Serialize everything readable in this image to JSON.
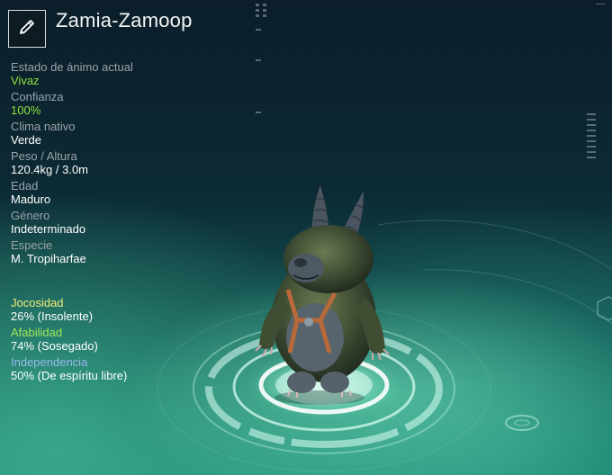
{
  "creature": {
    "name": "Zamia-Zamoop"
  },
  "stats": [
    {
      "label": "Estado de ánimo actual",
      "value": "Vivaz",
      "highlight": "#8ee13a"
    },
    {
      "label": "Confianza",
      "value": "100%",
      "highlight": "#8ee13a"
    },
    {
      "label": "Clima nativo",
      "value": "Verde"
    },
    {
      "label": "Peso / Altura",
      "value": "120.4kg / 3.0m"
    },
    {
      "label": "Edad",
      "value": "Maduro"
    },
    {
      "label": "Género",
      "value": "Indeterminado"
    },
    {
      "label": "Especie",
      "value": "M. Tropiharfae"
    }
  ],
  "traits": [
    {
      "label": "Jocosidad",
      "value": "26% (Insolente)",
      "color": "#f2ee7a"
    },
    {
      "label": "Afabilidad",
      "value": "74% (Sosegado)",
      "color": "#9ee85a"
    },
    {
      "label": "Independencia",
      "value": "50% (De espíritu libre)",
      "color": "#9ab9ee"
    }
  ],
  "icons": {
    "edit": "pencil-icon"
  }
}
